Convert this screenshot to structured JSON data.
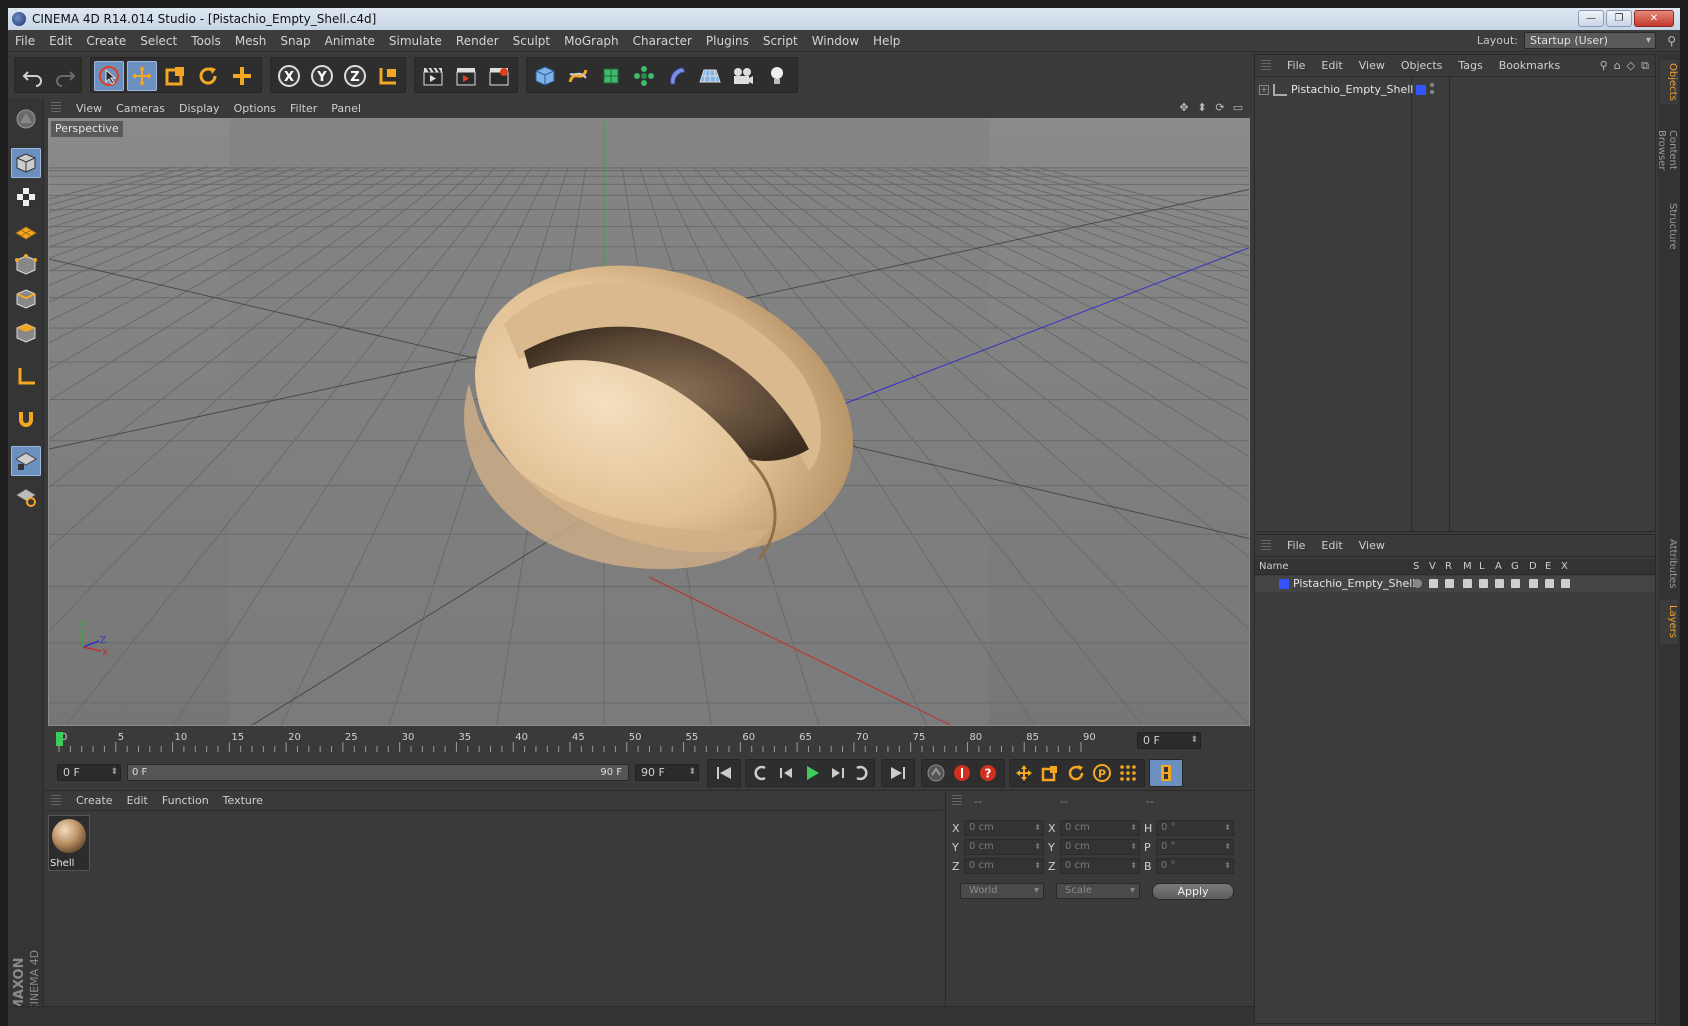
{
  "window": {
    "title": "CINEMA 4D R14.014 Studio - [Pistachio_Empty_Shell.c4d]",
    "controls": {
      "minimize": "—",
      "restore": "❐",
      "close": "✕"
    }
  },
  "menubar": {
    "items": [
      "File",
      "Edit",
      "Create",
      "Select",
      "Tools",
      "Mesh",
      "Snap",
      "Animate",
      "Simulate",
      "Render",
      "Sculpt",
      "MoGraph",
      "Character",
      "Plugins",
      "Script",
      "Window",
      "Help"
    ],
    "layout_label": "Layout:",
    "layout_value": "Startup (User)"
  },
  "viewport": {
    "menu": [
      "View",
      "Cameras",
      "Display",
      "Options",
      "Filter",
      "Panel"
    ],
    "label": "Perspective",
    "axis_labels": {
      "y": "Y",
      "z": "Z",
      "x": "X"
    },
    "colors": {
      "background": "#7d7d7d",
      "grid": "#6a6a6a",
      "x_axis": "#c03030",
      "y_axis": "#2fae2f",
      "z_axis": "#3030c8",
      "shell": "#e6c9a0"
    }
  },
  "timeline": {
    "ticks": [
      "0",
      "5",
      "10",
      "15",
      "20",
      "25",
      "30",
      "35",
      "40",
      "45",
      "50",
      "55",
      "60",
      "65",
      "70",
      "75",
      "80",
      "85",
      "90"
    ],
    "current_frame": "0 F",
    "start_field": "0 F",
    "range_start": "0 F",
    "range_end": "90 F",
    "end_field": "90 F"
  },
  "material_manager": {
    "menu": [
      "Create",
      "Edit",
      "Function",
      "Texture"
    ],
    "materials": [
      {
        "name": "Shell"
      }
    ]
  },
  "coordinates": {
    "headers": [
      "--",
      "--",
      "--"
    ],
    "rows": [
      {
        "a1": "X",
        "v1": "0 cm",
        "a2": "X",
        "v2": "0 cm",
        "a3": "H",
        "v3": "0 °"
      },
      {
        "a1": "Y",
        "v1": "0 cm",
        "a2": "Y",
        "v2": "0 cm",
        "a3": "P",
        "v3": "0 °"
      },
      {
        "a1": "Z",
        "v1": "0 cm",
        "a2": "Z",
        "v2": "0 cm",
        "a3": "B",
        "v3": "0 °"
      }
    ],
    "space_select": "World",
    "mode_select": "Scale",
    "apply_label": "Apply"
  },
  "object_manager": {
    "menu": [
      "File",
      "Edit",
      "View",
      "Objects",
      "Tags",
      "Bookmarks"
    ],
    "objects": [
      {
        "name": "Pistachio_Empty_Shell",
        "layer_color": "#3355ff"
      }
    ]
  },
  "layer_manager": {
    "menu": [
      "File",
      "Edit",
      "View"
    ],
    "columns": [
      "Name",
      "S",
      "V",
      "R",
      "M",
      "L",
      "A",
      "G",
      "D",
      "E",
      "X"
    ],
    "layers": [
      {
        "name": "Pistachio_Empty_Shell",
        "color": "#3355ff"
      }
    ]
  },
  "side_tabs": [
    "Objects",
    "Content Browser",
    "Structure",
    "Attributes",
    "Layers"
  ],
  "logo": {
    "brand": "MAXON",
    "product": "CINEMA 4D"
  }
}
